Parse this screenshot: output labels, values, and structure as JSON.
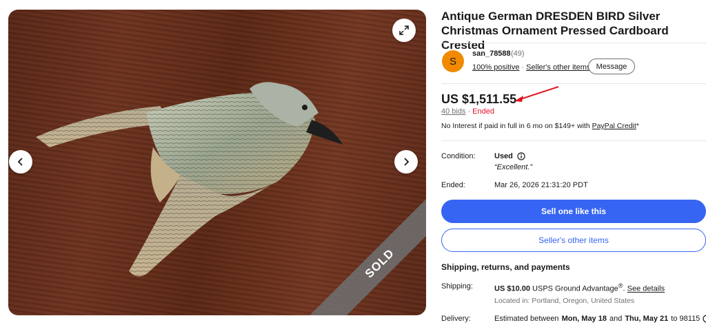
{
  "gallery": {
    "sold_label": "SOLD",
    "expand_icon": "expand-arrows-icon",
    "prev_icon": "chevron-left-icon",
    "next_icon": "chevron-right-icon"
  },
  "listing": {
    "title": "Antique German DRESDEN BIRD Silver Christmas Ornament Pressed Cardboard Crested"
  },
  "seller": {
    "avatar_letter": "S",
    "name": "san_78588",
    "feedback_count": "(49)",
    "positive": "100% positive",
    "other_items_link": "Seller's other items",
    "message_button": "Message"
  },
  "price": {
    "amount": "US $1,511.55",
    "bids": "40 bids",
    "separator": "·",
    "status": "Ended"
  },
  "paypal": {
    "text": "No Interest if paid in full in 6 mo on $149+ with ",
    "link": "PayPal Credit",
    "suffix": "*"
  },
  "details": {
    "condition_label": "Condition:",
    "condition_value": "Used",
    "condition_quote": "“Excellent.”",
    "ended_label": "Ended:",
    "ended_value": "Mar 26, 2026 21:31:20 PDT"
  },
  "actions": {
    "sell_one": "Sell one like this",
    "other_items": "Seller's other items"
  },
  "shipping": {
    "heading": "Shipping, returns, and payments",
    "shipping_label": "Shipping:",
    "cost": "US $10.00",
    "service": " USPS Ground Advantage",
    "reg_mark": "®",
    "see_details": "See details",
    "location": "Located in: Portland, Oregon, United States",
    "delivery_label": "Delivery:",
    "delivery_prefix": "Estimated between",
    "delivery_start": "Mon, May 18",
    "delivery_and": "and",
    "delivery_end": "Thu, May 21",
    "delivery_to": "to 98115"
  },
  "colors": {
    "primary_blue": "#3665f3",
    "ended_red": "#e0102a",
    "avatar_orange": "#f18a00",
    "annotation_red": "#e0141e"
  }
}
